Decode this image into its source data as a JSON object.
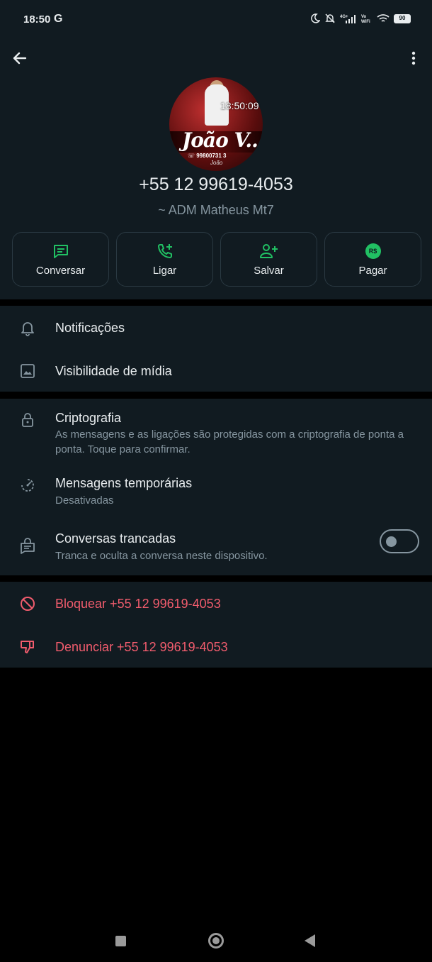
{
  "status_bar": {
    "time": "18:50",
    "carrier_glyph": "G",
    "network": "4G+",
    "vowifi": "Vo WiFi",
    "battery": "90"
  },
  "header": {
    "back_icon": "arrow-left-icon",
    "menu_icon": "more-vertical-icon",
    "avatar_text": "João V..",
    "avatar_phone": "☏ 99800731 3",
    "avatar_signature": "João",
    "timestamp_overlay": "18:50:09",
    "contact_name": "+55 12 99619-4053",
    "contact_subtitle": "~ ADM Matheus Mt7"
  },
  "actions": [
    {
      "label": "Conversar",
      "icon": "chat-icon"
    },
    {
      "label": "Ligar",
      "icon": "phone-add-icon"
    },
    {
      "label": "Salvar",
      "icon": "person-add-icon"
    },
    {
      "label": "Pagar",
      "icon": "payment-icon",
      "badge": "R$"
    }
  ],
  "settings_section_1": [
    {
      "title": "Notificações",
      "icon": "bell-icon"
    },
    {
      "title": "Visibilidade de mídia",
      "icon": "image-icon"
    }
  ],
  "settings_section_2": [
    {
      "title": "Criptografia",
      "desc": "As mensagens e as ligações são protegidas com a criptografia de ponta a ponta. Toque para confirmar.",
      "icon": "lock-icon"
    },
    {
      "title": "Mensagens temporárias",
      "desc": "Desativadas",
      "icon": "timer-icon"
    },
    {
      "title": "Conversas trancadas",
      "desc": "Tranca e oculta a conversa neste dispositivo.",
      "icon": "locked-chat-icon",
      "toggle_on": false
    }
  ],
  "danger_section": [
    {
      "title": "Bloquear +55 12 99619-4053",
      "icon": "block-icon"
    },
    {
      "title": "Denunciar +55 12 99619-4053",
      "icon": "thumbs-down-icon"
    }
  ],
  "colors": {
    "background": "#111b21",
    "accent_green": "#21c063",
    "danger_red": "#f15c6d",
    "secondary_text": "#8696a0"
  }
}
